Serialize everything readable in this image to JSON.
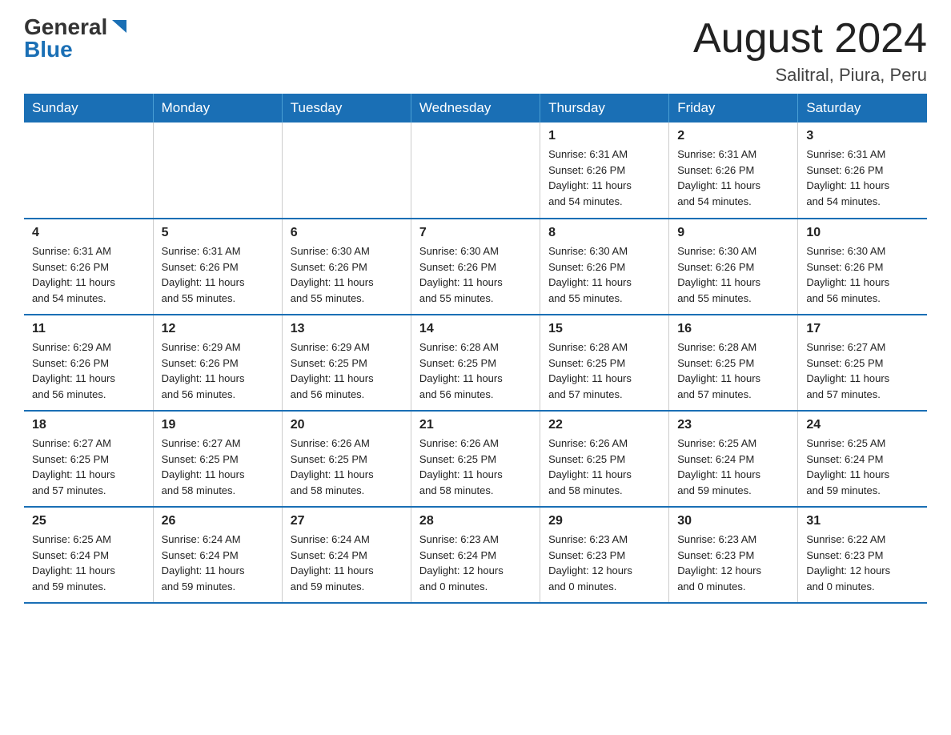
{
  "header": {
    "logo_general": "General",
    "logo_blue": "Blue",
    "month_title": "August 2024",
    "location": "Salitral, Piura, Peru"
  },
  "weekdays": [
    "Sunday",
    "Monday",
    "Tuesday",
    "Wednesday",
    "Thursday",
    "Friday",
    "Saturday"
  ],
  "weeks": [
    [
      {
        "day": "",
        "info": ""
      },
      {
        "day": "",
        "info": ""
      },
      {
        "day": "",
        "info": ""
      },
      {
        "day": "",
        "info": ""
      },
      {
        "day": "1",
        "info": "Sunrise: 6:31 AM\nSunset: 6:26 PM\nDaylight: 11 hours\nand 54 minutes."
      },
      {
        "day": "2",
        "info": "Sunrise: 6:31 AM\nSunset: 6:26 PM\nDaylight: 11 hours\nand 54 minutes."
      },
      {
        "day": "3",
        "info": "Sunrise: 6:31 AM\nSunset: 6:26 PM\nDaylight: 11 hours\nand 54 minutes."
      }
    ],
    [
      {
        "day": "4",
        "info": "Sunrise: 6:31 AM\nSunset: 6:26 PM\nDaylight: 11 hours\nand 54 minutes."
      },
      {
        "day": "5",
        "info": "Sunrise: 6:31 AM\nSunset: 6:26 PM\nDaylight: 11 hours\nand 55 minutes."
      },
      {
        "day": "6",
        "info": "Sunrise: 6:30 AM\nSunset: 6:26 PM\nDaylight: 11 hours\nand 55 minutes."
      },
      {
        "day": "7",
        "info": "Sunrise: 6:30 AM\nSunset: 6:26 PM\nDaylight: 11 hours\nand 55 minutes."
      },
      {
        "day": "8",
        "info": "Sunrise: 6:30 AM\nSunset: 6:26 PM\nDaylight: 11 hours\nand 55 minutes."
      },
      {
        "day": "9",
        "info": "Sunrise: 6:30 AM\nSunset: 6:26 PM\nDaylight: 11 hours\nand 55 minutes."
      },
      {
        "day": "10",
        "info": "Sunrise: 6:30 AM\nSunset: 6:26 PM\nDaylight: 11 hours\nand 56 minutes."
      }
    ],
    [
      {
        "day": "11",
        "info": "Sunrise: 6:29 AM\nSunset: 6:26 PM\nDaylight: 11 hours\nand 56 minutes."
      },
      {
        "day": "12",
        "info": "Sunrise: 6:29 AM\nSunset: 6:26 PM\nDaylight: 11 hours\nand 56 minutes."
      },
      {
        "day": "13",
        "info": "Sunrise: 6:29 AM\nSunset: 6:25 PM\nDaylight: 11 hours\nand 56 minutes."
      },
      {
        "day": "14",
        "info": "Sunrise: 6:28 AM\nSunset: 6:25 PM\nDaylight: 11 hours\nand 56 minutes."
      },
      {
        "day": "15",
        "info": "Sunrise: 6:28 AM\nSunset: 6:25 PM\nDaylight: 11 hours\nand 57 minutes."
      },
      {
        "day": "16",
        "info": "Sunrise: 6:28 AM\nSunset: 6:25 PM\nDaylight: 11 hours\nand 57 minutes."
      },
      {
        "day": "17",
        "info": "Sunrise: 6:27 AM\nSunset: 6:25 PM\nDaylight: 11 hours\nand 57 minutes."
      }
    ],
    [
      {
        "day": "18",
        "info": "Sunrise: 6:27 AM\nSunset: 6:25 PM\nDaylight: 11 hours\nand 57 minutes."
      },
      {
        "day": "19",
        "info": "Sunrise: 6:27 AM\nSunset: 6:25 PM\nDaylight: 11 hours\nand 58 minutes."
      },
      {
        "day": "20",
        "info": "Sunrise: 6:26 AM\nSunset: 6:25 PM\nDaylight: 11 hours\nand 58 minutes."
      },
      {
        "day": "21",
        "info": "Sunrise: 6:26 AM\nSunset: 6:25 PM\nDaylight: 11 hours\nand 58 minutes."
      },
      {
        "day": "22",
        "info": "Sunrise: 6:26 AM\nSunset: 6:25 PM\nDaylight: 11 hours\nand 58 minutes."
      },
      {
        "day": "23",
        "info": "Sunrise: 6:25 AM\nSunset: 6:24 PM\nDaylight: 11 hours\nand 59 minutes."
      },
      {
        "day": "24",
        "info": "Sunrise: 6:25 AM\nSunset: 6:24 PM\nDaylight: 11 hours\nand 59 minutes."
      }
    ],
    [
      {
        "day": "25",
        "info": "Sunrise: 6:25 AM\nSunset: 6:24 PM\nDaylight: 11 hours\nand 59 minutes."
      },
      {
        "day": "26",
        "info": "Sunrise: 6:24 AM\nSunset: 6:24 PM\nDaylight: 11 hours\nand 59 minutes."
      },
      {
        "day": "27",
        "info": "Sunrise: 6:24 AM\nSunset: 6:24 PM\nDaylight: 11 hours\nand 59 minutes."
      },
      {
        "day": "28",
        "info": "Sunrise: 6:23 AM\nSunset: 6:24 PM\nDaylight: 12 hours\nand 0 minutes."
      },
      {
        "day": "29",
        "info": "Sunrise: 6:23 AM\nSunset: 6:23 PM\nDaylight: 12 hours\nand 0 minutes."
      },
      {
        "day": "30",
        "info": "Sunrise: 6:23 AM\nSunset: 6:23 PM\nDaylight: 12 hours\nand 0 minutes."
      },
      {
        "day": "31",
        "info": "Sunrise: 6:22 AM\nSunset: 6:23 PM\nDaylight: 12 hours\nand 0 minutes."
      }
    ]
  ]
}
